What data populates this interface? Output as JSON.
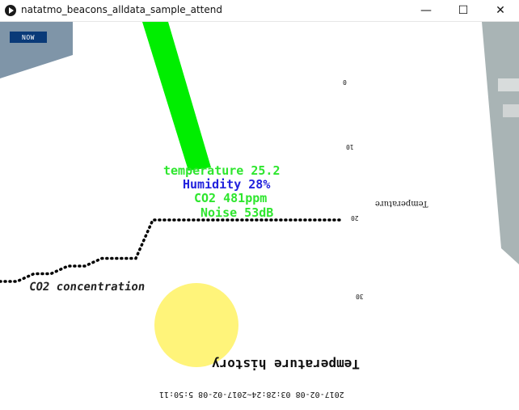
{
  "window": {
    "title": "natatmo_beacons_alldata_sample_attend",
    "minimize_glyph": "—",
    "maximize_glyph": "☐",
    "close_glyph": "✕"
  },
  "controls": {
    "now_label": "NOW"
  },
  "readouts": {
    "temperature": "temperature 25.2",
    "humidity": "Humidity 28%",
    "co2": "CO2 481ppm",
    "noise": "Noise 53dB"
  },
  "labels": {
    "co2_concentration": "CO2 concentration",
    "temperature_history": "Temperature history",
    "time_range": "2017-02-08 03:28:24~2017-02-08 5:50:11",
    "temperature_axis": "Temperature"
  },
  "chart_data": {
    "type": "line",
    "title": "Temperature history",
    "ylabel": "Temperature",
    "yticks": [
      "0",
      "10",
      "20",
      "30"
    ],
    "series": [
      {
        "values": [
          28,
          28,
          27,
          27,
          26,
          26,
          25,
          25,
          25,
          20,
          20,
          20,
          20,
          20,
          20,
          20,
          20,
          20,
          20,
          20,
          20
        ]
      }
    ]
  },
  "colors": {
    "temperature": "#2ee62e",
    "humidity": "#2222dd",
    "co2_circle": "#fff47a",
    "now_button": "#0a3a78",
    "pointer": "#00ee00"
  },
  "icons": {
    "app": "play-circle-icon",
    "minimize": "minimize-icon",
    "maximize": "maximize-icon",
    "close": "close-icon"
  }
}
